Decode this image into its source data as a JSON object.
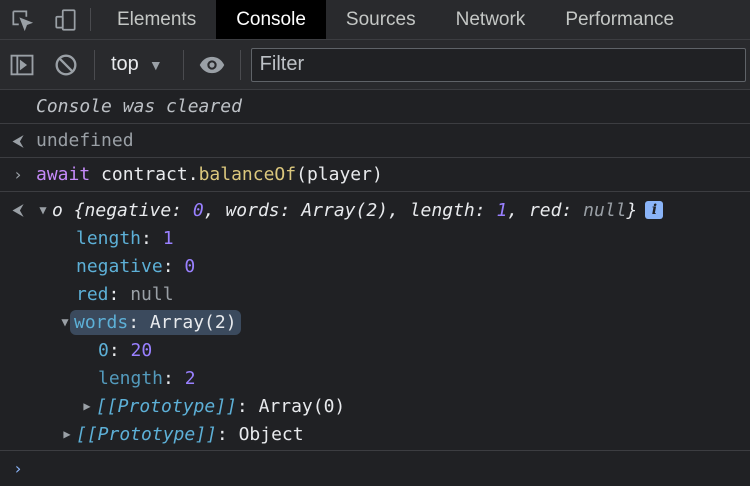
{
  "tabs": [
    {
      "label": "Elements",
      "active": false
    },
    {
      "label": "Console",
      "active": true
    },
    {
      "label": "Sources",
      "active": false
    },
    {
      "label": "Network",
      "active": false
    },
    {
      "label": "Performance",
      "active": false
    }
  ],
  "toolbar": {
    "context": "top",
    "filter_placeholder": "Filter"
  },
  "console": {
    "cleared": "Console was cleared",
    "result1": "undefined",
    "command": {
      "await": "await",
      "object": "contract",
      "dot": ".",
      "method": "balanceOf",
      "args": "(player)"
    },
    "result": {
      "name": "o",
      "preview": {
        "open": "{",
        "k1": "negative",
        "v1": "0",
        "k2": "words",
        "v2": "Array(2)",
        "k3": "length",
        "v3": "1",
        "k4": "red",
        "v4": "null",
        "close": "}"
      },
      "info": "i",
      "props": [
        {
          "key": "length",
          "value": "1"
        },
        {
          "key": "negative",
          "value": "0"
        },
        {
          "key": "red",
          "value": "null"
        }
      ],
      "words": {
        "key": "words",
        "value": "Array(2)",
        "items": [
          {
            "key": "0",
            "value": "20"
          },
          {
            "key": "length",
            "value": "2"
          }
        ],
        "proto_key": "[[Prototype]]",
        "proto_value": "Array(0)"
      },
      "proto_key": "[[Prototype]]",
      "proto_value": "Object"
    }
  },
  "colors": {
    "background": "#202124",
    "key": "#5db0d7",
    "number": "#9980ff",
    "accent": "#8ab4f8"
  },
  "icons": [
    "inspect-element-icon",
    "device-toolbar-icon",
    "sidebar-toggle-icon",
    "clear-console-icon",
    "live-expression-eye-icon",
    "chevron-right-icon",
    "result-arrow-icon"
  ]
}
